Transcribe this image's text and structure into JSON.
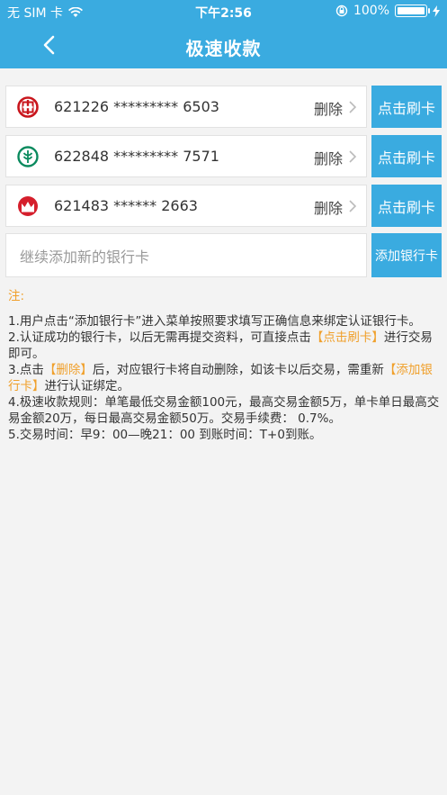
{
  "status": {
    "carrier": "无 SIM 卡",
    "time": "下午2:56",
    "battery": "100%"
  },
  "nav": {
    "title": "极速收款"
  },
  "cards": [
    {
      "number": "621226 ********* 6503",
      "delete": "删除",
      "swipe": "点击刷卡",
      "logo": "icbc-logo",
      "color": "#c9161d"
    },
    {
      "number": "622848 ********* 7571",
      "delete": "删除",
      "swipe": "点击刷卡",
      "logo": "abc-logo",
      "color": "#0a8a5e"
    },
    {
      "number": "621483 ****** 2663",
      "delete": "删除",
      "swipe": "点击刷卡",
      "logo": "cmb-logo",
      "color": "#d51f2c"
    }
  ],
  "add": {
    "placeholder": "继续添加新的银行卡",
    "button": "添加银行卡"
  },
  "notes": {
    "head": "注:",
    "n1": "1.用户点击“添加银行卡”进入菜单按照要求填写正确信息来绑定认证银行卡。",
    "n2a": "2.认证成功的银行卡，以后无需再提交资料，可直接点击",
    "n2b": "【点击刷卡】",
    "n2c": "进行交易即可。",
    "n3a": "3.点击",
    "n3b": "【删除】",
    "n3c": "后，对应银行卡将自动删除，如该卡以后交易，需重新",
    "n3d": "【添加银行卡】",
    "n3e": "进行认证绑定。",
    "n4": "4.极速收款规则：单笔最低交易金额100元，最高交易金额5万，单卡单日最高交易金额20万，每日最高交易金额50万。交易手续费： 0.7%。",
    "n5": "5.交易时间：早9：00—晚21：00  到账时间：T+0到账。"
  },
  "colors": {
    "accent": "#3aabe0",
    "highlight": "#f0a02c"
  }
}
